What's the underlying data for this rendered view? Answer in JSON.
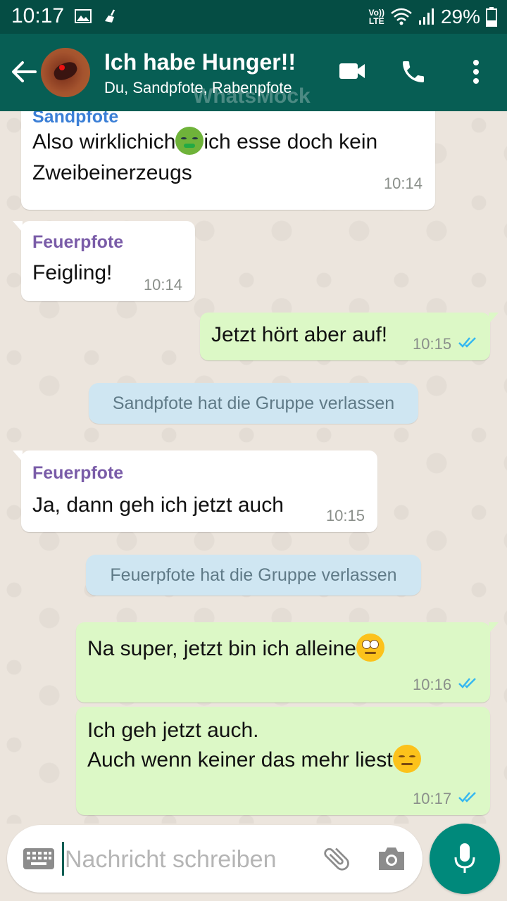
{
  "status_bar": {
    "time": "10:17",
    "volte": [
      "Vo))",
      "LTE"
    ],
    "battery": "29%",
    "icons": [
      "image-icon",
      "broom-icon",
      "wifi-icon",
      "signal-icon",
      "battery-icon"
    ]
  },
  "header": {
    "title": "Ich habe Hunger!!",
    "subtitle": "Du, Sandpfote, Rabenpfote",
    "watermark": "WhatsMock",
    "icons": [
      "back-arrow-icon",
      "video-call-icon",
      "phone-icon",
      "more-vert-icon"
    ]
  },
  "messages": [
    {
      "type": "in",
      "sender": "Sandpfote",
      "sender_color": "#3b7fd6",
      "lines": [
        "Also wirklichich",
        "ich esse doch kein",
        "Zweibeinerzeugs"
      ],
      "emoji": "nauseated-face-emoji",
      "time": "10:14"
    },
    {
      "type": "in",
      "sender": "Feuerpfote",
      "sender_color": "#7a5ca8",
      "lines": [
        "Feigling!"
      ],
      "time": "10:14"
    },
    {
      "type": "out",
      "lines": [
        "Jetzt hört aber auf!"
      ],
      "time": "10:15",
      "read": true
    },
    {
      "type": "system",
      "text": "Sandpfote hat die Gruppe verlassen"
    },
    {
      "type": "in",
      "sender": "Feuerpfote",
      "sender_color": "#7a5ca8",
      "lines": [
        "Ja, dann geh ich jetzt auch"
      ],
      "time": "10:15"
    },
    {
      "type": "system",
      "text": "Feuerpfote hat die Gruppe verlassen"
    },
    {
      "type": "out",
      "lines": [
        "Na super, jetzt bin ich alleine"
      ],
      "emoji": "rolling-eyes-emoji",
      "time": "10:16",
      "read": true
    },
    {
      "type": "out",
      "lines": [
        "Ich geh jetzt auch.",
        "Auch wenn keiner das mehr liest"
      ],
      "emoji": "expressionless-face-emoji",
      "time": "10:17",
      "read": true
    }
  ],
  "input": {
    "placeholder": "Nachricht schreiben",
    "icons": [
      "keyboard-icon",
      "attach-icon",
      "camera-icon",
      "mic-icon"
    ]
  },
  "colors": {
    "status_bar": "#054d44",
    "app_bar": "#075e54",
    "outgoing_bubble": "#dcf8c6",
    "incoming_bubble": "#ffffff",
    "system_bubble": "#cfe6f2",
    "read_ticks": "#34b7f1",
    "mic_button": "#00897b"
  }
}
